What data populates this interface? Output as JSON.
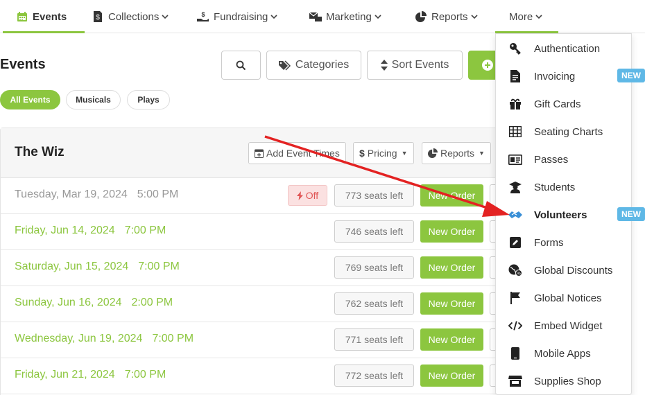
{
  "nav": {
    "items": [
      {
        "label": "Events",
        "icon": "calendar-icon"
      },
      {
        "label": "Collections",
        "icon": "receipt-icon"
      },
      {
        "label": "Fundraising",
        "icon": "donate-icon"
      },
      {
        "label": "Marketing",
        "icon": "mail-bullhorn-icon"
      },
      {
        "label": "Reports",
        "icon": "pie-chart-icon"
      },
      {
        "label": "More",
        "icon": ""
      }
    ],
    "accent": "#8cc63f"
  },
  "page": {
    "title": "Events",
    "categories_label": "Categories",
    "sort_label": "Sort Events"
  },
  "filters": [
    "All Events",
    "Musicals",
    "Plays"
  ],
  "event": {
    "name": "The Wiz",
    "add_times_label": "Add Event Times",
    "pricing_label": "Pricing",
    "reports_label": "Reports",
    "off_label": "Off",
    "new_order_label": "New Order",
    "rows": [
      {
        "date": "Tuesday, Mar 19, 2024",
        "time": "5:00 PM",
        "seats": "773 seats left",
        "past": true
      },
      {
        "date": "Friday, Jun 14, 2024",
        "time": "7:00 PM",
        "seats": "746 seats left",
        "past": false
      },
      {
        "date": "Saturday, Jun 15, 2024",
        "time": "7:00 PM",
        "seats": "769 seats left",
        "past": false
      },
      {
        "date": "Sunday, Jun 16, 2024",
        "time": "2:00 PM",
        "seats": "762 seats left",
        "past": false
      },
      {
        "date": "Wednesday, Jun 19, 2024",
        "time": "7:00 PM",
        "seats": "771 seats left",
        "past": false
      },
      {
        "date": "Friday, Jun 21, 2024",
        "time": "7:00 PM",
        "seats": "772 seats left",
        "past": false
      }
    ]
  },
  "more_menu": {
    "new_badge": "NEW",
    "items": [
      {
        "label": "Authentication",
        "icon": "key-icon"
      },
      {
        "label": "Invoicing",
        "icon": "invoice-icon",
        "new": true
      },
      {
        "label": "Gift Cards",
        "icon": "gift-icon"
      },
      {
        "label": "Seating Charts",
        "icon": "table-grid-icon"
      },
      {
        "label": "Passes",
        "icon": "id-card-icon"
      },
      {
        "label": "Students",
        "icon": "graduate-icon"
      },
      {
        "label": "Volunteers",
        "icon": "handshake-icon",
        "new": true,
        "highlight": true
      },
      {
        "label": "Forms",
        "icon": "edit-form-icon"
      },
      {
        "label": "Global Discounts",
        "icon": "globe-discount-icon"
      },
      {
        "label": "Global Notices",
        "icon": "flag-icon"
      },
      {
        "label": "Embed Widget",
        "icon": "code-icon"
      },
      {
        "label": "Mobile Apps",
        "icon": "mobile-icon"
      },
      {
        "label": "Supplies Shop",
        "icon": "store-icon"
      }
    ]
  }
}
